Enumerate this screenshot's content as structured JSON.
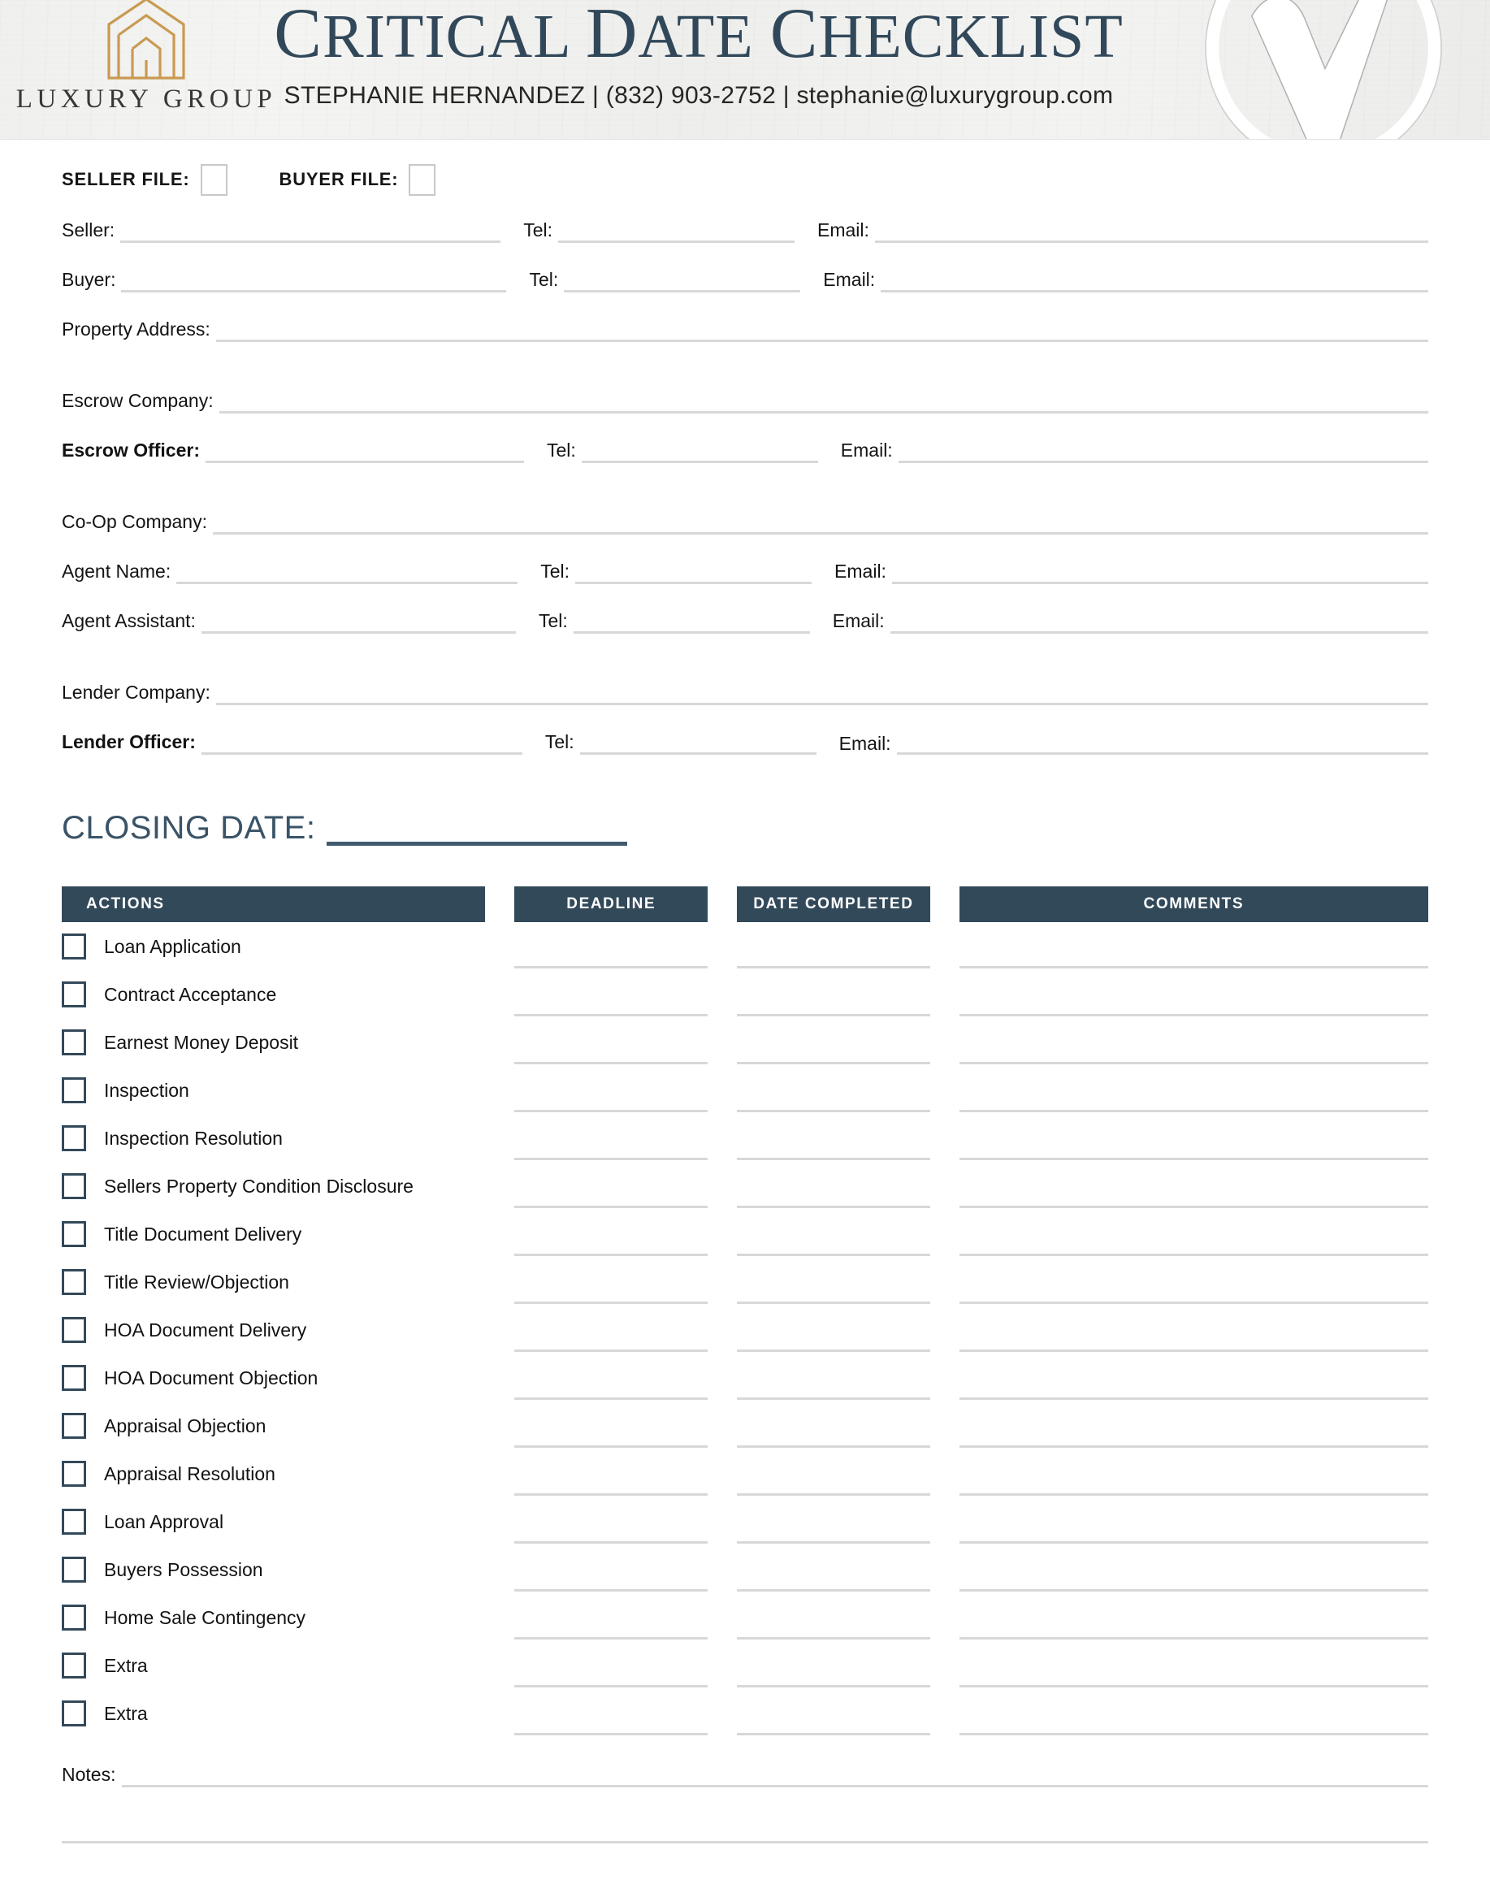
{
  "header": {
    "logo": {
      "icon": "house-outline-logo",
      "wordmark": "LUXURY GROUP",
      "color": "#c99a52"
    },
    "title_small": "RITICAL",
    "title_parts": [
      "C",
      "RITICAL ",
      "D",
      "ATE ",
      "C",
      "HECKLIST"
    ],
    "title_full": "CRITICAL DATE CHECKLIST",
    "title_color": "#31485a",
    "subtitle": "STEPHANIE HERNANDEZ |  (832) 903-2752 |  stephanie@luxurygroup.com",
    "agent_name": "STEPHANIE HERNANDEZ",
    "agent_phone": "(832) 903-2752",
    "agent_email": "stephanie@luxurygroup.com",
    "watermark_icon": "checkmark-circle-watermark"
  },
  "file_type": {
    "seller_label": "SELLER FILE:",
    "buyer_label": "BUYER FILE:"
  },
  "labels": {
    "tel": "Tel:",
    "email": "Email:"
  },
  "fields": [
    {
      "label": "Seller:",
      "name": "seller",
      "tel": true,
      "email": true,
      "bold": false,
      "spacing": "normal"
    },
    {
      "label": "Buyer:",
      "name": "buyer",
      "tel": true,
      "email": true,
      "bold": false,
      "spacing": "normal"
    },
    {
      "label": "Property Address:",
      "name": "property-address",
      "tel": false,
      "email": false,
      "bold": false,
      "spacing": "normal"
    },
    {
      "label": "Escrow Company:",
      "name": "escrow-company",
      "tel": false,
      "email": false,
      "bold": false,
      "spacing": "section"
    },
    {
      "label": "Escrow Officer:",
      "name": "escrow-officer",
      "tel": true,
      "email": true,
      "bold": true,
      "spacing": "normal"
    },
    {
      "label": "Co-Op Company:",
      "name": "co-op-company",
      "tel": false,
      "email": false,
      "bold": false,
      "spacing": "section"
    },
    {
      "label": "Agent Name:",
      "name": "agent-name",
      "tel": true,
      "email": true,
      "bold": false,
      "spacing": "normal"
    },
    {
      "label": "Agent Assistant:",
      "name": "agent-assistant",
      "tel": true,
      "email": true,
      "bold": false,
      "spacing": "normal"
    },
    {
      "label": "Lender Company:",
      "name": "lender-company",
      "tel": false,
      "email": false,
      "bold": false,
      "spacing": "section"
    },
    {
      "label": "Lender Officer:",
      "name": "lender-officer",
      "tel": true,
      "email": true,
      "bold": true,
      "spacing": "normal"
    }
  ],
  "closing": {
    "label": "CLOSING DATE:",
    "value": "",
    "color": "#3a5367"
  },
  "table": {
    "header_bg": "#32495a",
    "header_text_color": "#ffffff",
    "columns": [
      "ACTIONS",
      "DEADLINE",
      "DATE COMPLETED",
      "COMMENTS"
    ],
    "rows": [
      {
        "action": "Loan Application",
        "deadline": "",
        "date_completed": "",
        "comments": ""
      },
      {
        "action": "Contract Acceptance",
        "deadline": "",
        "date_completed": "",
        "comments": ""
      },
      {
        "action": "Earnest Money Deposit",
        "deadline": "",
        "date_completed": "",
        "comments": ""
      },
      {
        "action": "Inspection",
        "deadline": "",
        "date_completed": "",
        "comments": ""
      },
      {
        "action": "Inspection Resolution",
        "deadline": "",
        "date_completed": "",
        "comments": ""
      },
      {
        "action": "Sellers Property Condition Disclosure",
        "deadline": "",
        "date_completed": "",
        "comments": ""
      },
      {
        "action": "Title Document Delivery",
        "deadline": "",
        "date_completed": "",
        "comments": ""
      },
      {
        "action": "Title Review/Objection",
        "deadline": "",
        "date_completed": "",
        "comments": ""
      },
      {
        "action": "HOA Document Delivery",
        "deadline": "",
        "date_completed": "",
        "comments": ""
      },
      {
        "action": "HOA Document Objection",
        "deadline": "",
        "date_completed": "",
        "comments": ""
      },
      {
        "action": "Appraisal Objection",
        "deadline": "",
        "date_completed": "",
        "comments": ""
      },
      {
        "action": "Appraisal Resolution",
        "deadline": "",
        "date_completed": "",
        "comments": ""
      },
      {
        "action": "Loan Approval",
        "deadline": "",
        "date_completed": "",
        "comments": ""
      },
      {
        "action": "Buyers Possession",
        "deadline": "",
        "date_completed": "",
        "comments": ""
      },
      {
        "action": "Home Sale Contingency",
        "deadline": "",
        "date_completed": "",
        "comments": ""
      },
      {
        "action": "Extra",
        "deadline": "",
        "date_completed": "",
        "comments": ""
      },
      {
        "action": "Extra",
        "deadline": "",
        "date_completed": "",
        "comments": ""
      }
    ]
  },
  "notes": {
    "label": "Notes:",
    "value": ""
  }
}
